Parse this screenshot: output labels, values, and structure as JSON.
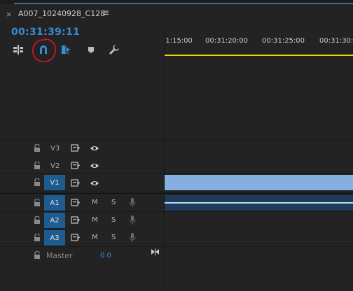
{
  "sequence": {
    "close_glyph": "×",
    "name": "A007_10240928_C128",
    "menu_glyph": "≡",
    "timecode": "00:31:39:11"
  },
  "toolbar": {
    "icons": [
      "insert-nest-icon",
      "snap-magnet-icon",
      "linked-selection-icon",
      "add-marker-icon",
      "timeline-settings-wrench-icon"
    ]
  },
  "ruler": {
    "labels": [
      ":1:15:00",
      "00:31:20:00",
      "00:31:25:00",
      "00:31:30:"
    ]
  },
  "video_tracks": [
    {
      "name": "V3"
    },
    {
      "name": "V2"
    },
    {
      "name": "V1"
    }
  ],
  "audio_tracks": [
    {
      "name": "A1",
      "mute": "M",
      "solo": "S"
    },
    {
      "name": "A2",
      "mute": "M",
      "solo": "S"
    },
    {
      "name": "A3",
      "mute": "M",
      "solo": "S"
    }
  ],
  "master": {
    "label": "Master",
    "value": "0.0"
  },
  "colors": {
    "accent_blue": "#3a8ad8",
    "track_target_blue": "#1e5c8f",
    "clip_video": "#86aee0",
    "playhead_bar": "#e8d600",
    "annotation_red": "#e0102a"
  }
}
